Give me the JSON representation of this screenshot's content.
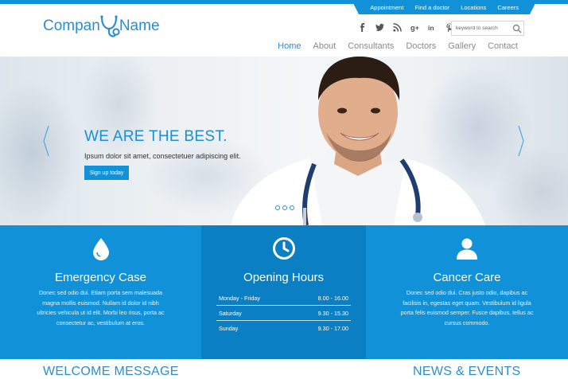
{
  "toplinks": [
    "Appointment",
    "Find a doctor",
    "Locations",
    "Careers"
  ],
  "logo": {
    "part1": "Compan",
    "part2": "Name"
  },
  "social": [
    "facebook-icon",
    "twitter-icon",
    "rss-icon",
    "google-plus-icon",
    "linkedin-icon",
    "pinterest-icon"
  ],
  "search": {
    "placeholder": "keyword to search"
  },
  "nav": [
    "Home",
    "About",
    "Consultants",
    "Doctors",
    "Gallery",
    "Contact"
  ],
  "hero": {
    "title": "WE ARE THE BEST.",
    "subtitle": "Ipsum dolor sit amet, consectetuer adipiscing elit.",
    "cta": "Sign up today"
  },
  "features": {
    "emergency": {
      "title": "Emergency Case",
      "text": "Donec sed odio dui. Etiam porta sem malesuada magna mollis euismod. Nullam id dolor id nibh ultricies vehicula ut id elit. Morbi leo risus, porta ac consectetur ac, vestibulum at eros."
    },
    "hours": {
      "title": "Opening Hours",
      "rows": [
        {
          "day": "Monday - Friday",
          "time": "8.00 - 16.00"
        },
        {
          "day": "Saturday",
          "time": "9.30 - 15.30"
        },
        {
          "day": "Sunday",
          "time": "9.30 - 17.00"
        }
      ]
    },
    "cancer": {
      "title": "Cancer Care",
      "text": "Donec sed odio dui. Cras justo odio, dapibus ac facilisis in, egestas eget quam. Vestibulum id ligula porta felis euismod semper. Fusce dapibus, tellus ac cursus commodo."
    }
  },
  "sections": {
    "welcome": "WELCOME MESSAGE",
    "news": "NEWS & EVENTS"
  },
  "colors": {
    "accent": "#1192d8",
    "accent_dark": "#0a7fc4",
    "brand_text": "#2c8ed1"
  }
}
